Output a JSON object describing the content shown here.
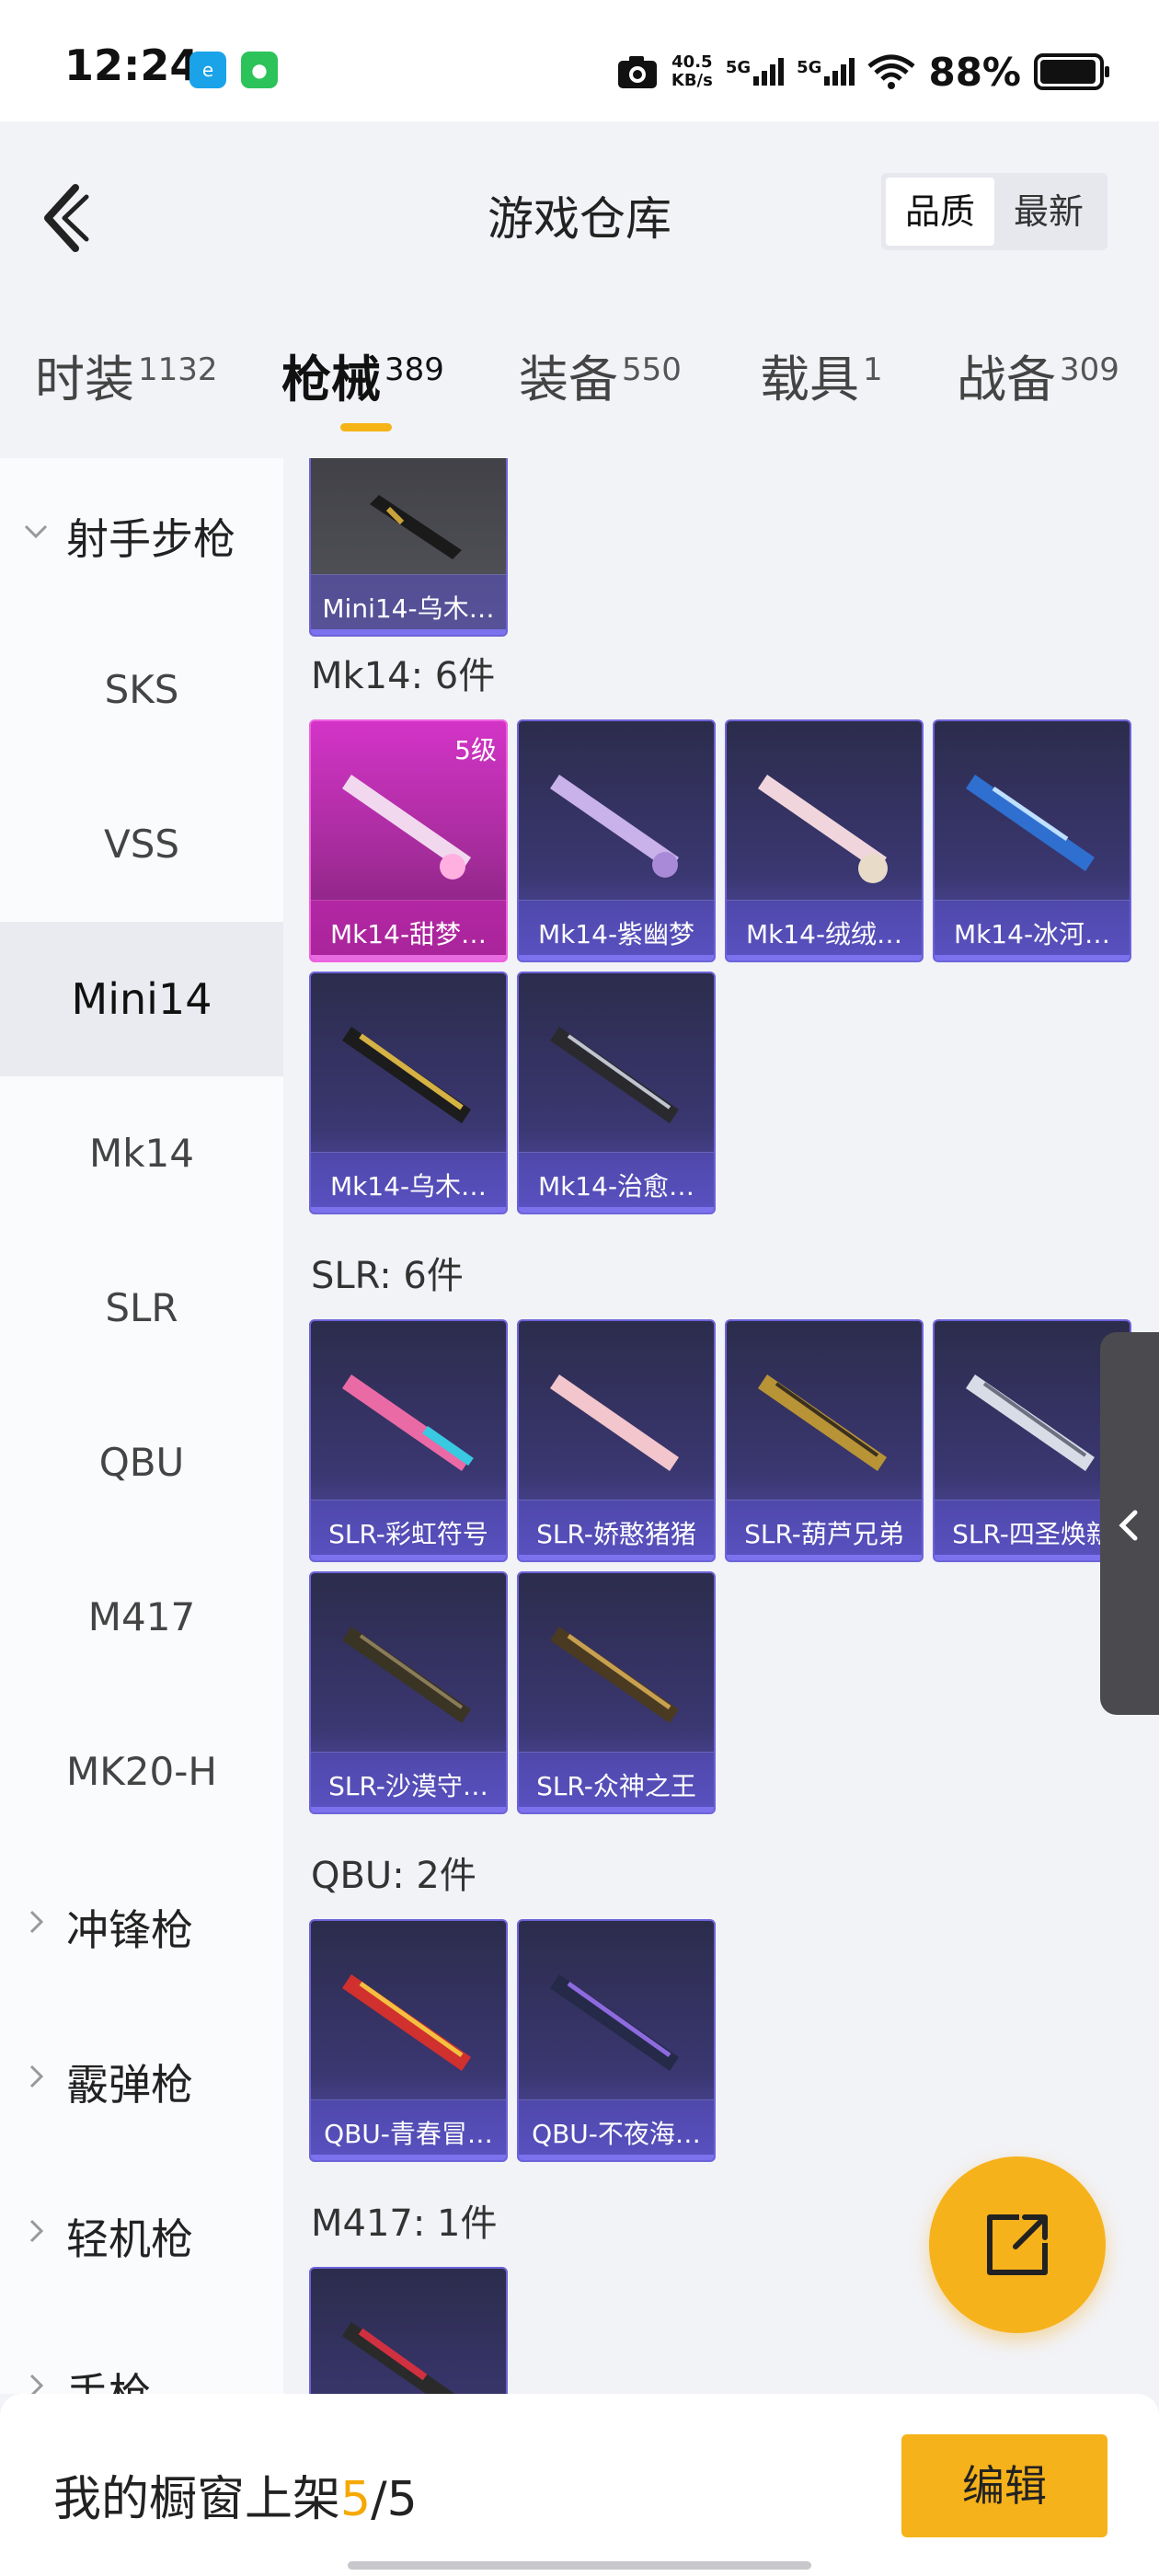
{
  "status_bar": {
    "time": "12:24",
    "speed_value": "40.5",
    "speed_unit": "KB/s",
    "net_1": "5G",
    "net_2": "5G",
    "battery": "88%",
    "icons": [
      "browser-app-icon",
      "wechat-icon",
      "camera-icon",
      "signal-icon",
      "wifi-icon",
      "battery-icon"
    ]
  },
  "header": {
    "title": "游戏仓库",
    "sort_quality": "品质",
    "sort_newest": "最新"
  },
  "tabs": [
    {
      "label": "时装",
      "count": "1132"
    },
    {
      "label": "枪械",
      "count": "389",
      "active": true
    },
    {
      "label": "装备",
      "count": "550"
    },
    {
      "label": "载具",
      "count": "1"
    },
    {
      "label": "战备",
      "count": "309"
    }
  ],
  "sidebar": {
    "category_sniper": "射手步枪",
    "sub": [
      "SKS",
      "VSS",
      "Mini14",
      "Mk14",
      "SLR",
      "QBU",
      "M417",
      "MK20-H"
    ],
    "active_sub": "Mini14",
    "category_smg": "冲锋枪",
    "category_shotgun": "霰弹枪",
    "category_lmg": "轻机枪",
    "category_pistol": "手枪"
  },
  "content": {
    "top_card": "Mini14-乌木…",
    "groups": [
      {
        "title": "Mk14: 6件",
        "items": [
          {
            "name": "Mk14-甜梦…",
            "level": "5级"
          },
          {
            "name": "Mk14-紫幽梦"
          },
          {
            "name": "Mk14-绒绒…"
          },
          {
            "name": "Mk14-冰河…"
          },
          {
            "name": "Mk14-乌木…"
          },
          {
            "name": "Mk14-治愈…"
          }
        ]
      },
      {
        "title": "SLR: 6件",
        "items": [
          {
            "name": "SLR-彩虹符号"
          },
          {
            "name": "SLR-娇憨猪猪"
          },
          {
            "name": "SLR-葫芦兄弟"
          },
          {
            "name": "SLR-四圣焕新"
          },
          {
            "name": "SLR-沙漠守…"
          },
          {
            "name": "SLR-众神之王"
          }
        ]
      },
      {
        "title": "QBU: 2件",
        "items": [
          {
            "name": "QBU-青春冒…"
          },
          {
            "name": "QBU-不夜海…"
          }
        ]
      },
      {
        "title": "M417: 1件",
        "items": [
          {
            "name": ""
          }
        ]
      }
    ]
  },
  "bottom_bar": {
    "shelf_label": "我的橱窗上架",
    "shelf_count": "5",
    "shelf_sep": "/",
    "shelf_total": "5",
    "edit_label": "编辑"
  },
  "colors": {
    "accent": "#f6b21b",
    "card_purple": "#3b3772",
    "card_pink": "#d334c7"
  }
}
